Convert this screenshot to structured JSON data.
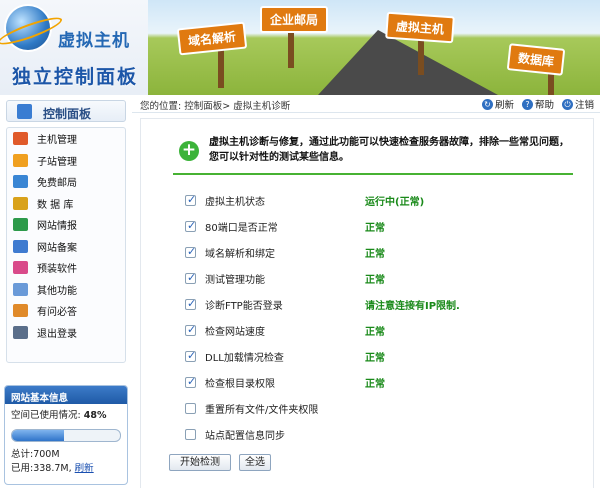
{
  "header": {
    "brand": "虚拟主机",
    "subtitle": "独立控制面板",
    "signs": [
      "域名解析",
      "企业邮局",
      "虚拟主机",
      "数据库"
    ]
  },
  "topbar": {
    "breadcrumb": "您的位置: 控制面板> 虚拟主机诊断",
    "refresh": "刷新",
    "help": "帮助",
    "logout": "注销"
  },
  "sidebar": {
    "panel_title": "控制面板",
    "items": [
      {
        "label": "主机管理",
        "icon": "house-icon",
        "color": "#e05a2a"
      },
      {
        "label": "子站管理",
        "icon": "sites-icon",
        "color": "#f0a020"
      },
      {
        "label": "免费邮局",
        "icon": "mail-icon",
        "color": "#3a86d4"
      },
      {
        "label": "数 据 库",
        "icon": "database-icon",
        "color": "#d9a21b"
      },
      {
        "label": "网站情报",
        "icon": "globe-icon",
        "color": "#2d9a4a"
      },
      {
        "label": "网站备案",
        "icon": "record-icon",
        "color": "#3f7bd0"
      },
      {
        "label": "预装软件",
        "icon": "software-icon",
        "color": "#d94a8a"
      },
      {
        "label": "其他功能",
        "icon": "other-icon",
        "color": "#6a9ad8"
      },
      {
        "label": "有问必答",
        "icon": "qa-icon",
        "color": "#e08a2a"
      },
      {
        "label": "退出登录",
        "icon": "logout-icon",
        "color": "#5a6e8a"
      }
    ]
  },
  "site_info": {
    "title": "网站基本信息",
    "usage_label": "空间已使用情况:",
    "usage_value": "48%",
    "usage_fraction": 0.48,
    "total": "总计:700M",
    "used": "已用:338.7M,",
    "refresh_link": "刷新"
  },
  "diagnosis": {
    "intro": "虚拟主机诊断与修复，通过此功能可以快速检查服务器故障，排除一些常见问题，您可以针对性的测试某些信息。",
    "checks": [
      {
        "label": "虚拟主机状态",
        "checked": true,
        "status": "运行中(正常)"
      },
      {
        "label": "80端口是否正常",
        "checked": true,
        "status": "正常"
      },
      {
        "label": "域名解析和绑定",
        "checked": true,
        "status": "正常"
      },
      {
        "label": "测试管理功能",
        "checked": true,
        "status": "正常"
      },
      {
        "label": "诊断FTP能否登录",
        "checked": true,
        "status": "请注意连接有IP限制."
      },
      {
        "label": "检查网站速度",
        "checked": true,
        "status": "正常"
      },
      {
        "label": "DLL加载情况检查",
        "checked": true,
        "status": "正常"
      },
      {
        "label": "检查根目录权限",
        "checked": true,
        "status": "正常"
      },
      {
        "label": "重置所有文件/文件夹权限",
        "checked": false,
        "status": ""
      },
      {
        "label": "站点配置信息同步",
        "checked": false,
        "status": ""
      }
    ],
    "start_button": "开始检测",
    "select_all_button": "全选"
  }
}
